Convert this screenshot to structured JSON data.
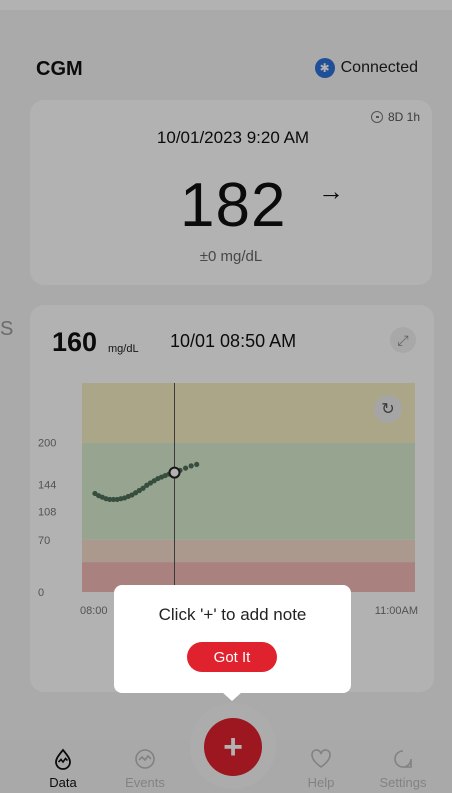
{
  "header": {
    "title": "CGM",
    "status": "Connected",
    "bluetooth_icon": "bluetooth-icon"
  },
  "current": {
    "datetime": "10/01/2023  9:20 AM",
    "value": "182",
    "trend": "→",
    "delta": "±0 mg/dL",
    "sensor_age": "8D 1h"
  },
  "latest": {
    "value": "160",
    "unit": "mg/dL",
    "time": "10/01  08:50 AM"
  },
  "chart_data": {
    "type": "line",
    "y_ticks": [
      "200",
      "144",
      "108",
      "70",
      "0"
    ],
    "x_labels": [
      "08:00",
      "11:00AM"
    ],
    "zones": [
      {
        "name": "high",
        "from": 200,
        "to": 280,
        "color": "#f6eec3"
      },
      {
        "name": "target",
        "from": 70,
        "to": 200,
        "color": "#d9edce"
      },
      {
        "name": "low",
        "from": 40,
        "to": 70,
        "color": "#f5dccb"
      },
      {
        "name": "very-low",
        "from": 0,
        "to": 40,
        "color": "#f3b9b7"
      }
    ],
    "cursor_time": "08:50",
    "series": [
      {
        "points": [
          [
            "08:07",
            132
          ],
          [
            "08:09",
            129
          ],
          [
            "08:11",
            127
          ],
          [
            "08:13",
            125
          ],
          [
            "08:15",
            124
          ],
          [
            "08:17",
            124
          ],
          [
            "08:19",
            124
          ],
          [
            "08:21",
            125
          ],
          [
            "08:23",
            126
          ],
          [
            "08:25",
            128
          ],
          [
            "08:27",
            130
          ],
          [
            "08:29",
            133
          ],
          [
            "08:31",
            136
          ],
          [
            "08:33",
            139
          ],
          [
            "08:35",
            143
          ],
          [
            "08:37",
            146
          ],
          [
            "08:39",
            149
          ],
          [
            "08:41",
            152
          ],
          [
            "08:43",
            154
          ],
          [
            "08:45",
            156
          ],
          [
            "08:47",
            158
          ],
          [
            "08:49",
            159
          ],
          [
            "08:50",
            160
          ],
          [
            "08:53",
            163
          ],
          [
            "08:56",
            166
          ],
          [
            "08:59",
            169
          ],
          [
            "09:02",
            171
          ]
        ]
      }
    ]
  },
  "tooltip": {
    "text": "Click '+' to add note",
    "button": "Got It"
  },
  "nav": {
    "data": "Data",
    "events": "Events",
    "add": "+",
    "help": "Help",
    "settings": "Settings"
  }
}
